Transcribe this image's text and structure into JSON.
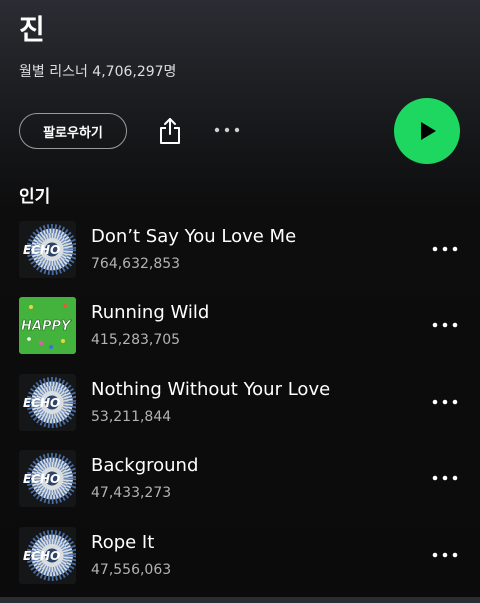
{
  "artist": {
    "name": "진",
    "monthly_listeners": "월별 리스너 4,706,297명"
  },
  "actions": {
    "follow_label": "팔로우하기",
    "share_icon": "share-icon",
    "more_icon": "more-horizontal-icon",
    "play_icon": "play-icon"
  },
  "popular": {
    "title": "인기",
    "tracks": [
      {
        "title": "Don’t Say You Love Me",
        "plays": "764,632,853",
        "album_art": "echo",
        "art_text": "ECHO"
      },
      {
        "title": "Running Wild",
        "plays": "415,283,705",
        "album_art": "happy",
        "art_text": "HAPPY"
      },
      {
        "title": "Nothing Without Your Love",
        "plays": "53,211,844",
        "album_art": "echo",
        "art_text": "ECHO"
      },
      {
        "title": "Background",
        "plays": "47,433,273",
        "album_art": "echo",
        "art_text": "ECHO"
      },
      {
        "title": "Rope It",
        "plays": "47,556,063",
        "album_art": "echo",
        "art_text": "ECHO"
      }
    ]
  },
  "colors": {
    "accent": "#1ed760",
    "background": "#0b0b0b",
    "header_top": "#2a2d33",
    "secondary_text": "#b3b3b3",
    "happy_art": "#3fae3a"
  }
}
